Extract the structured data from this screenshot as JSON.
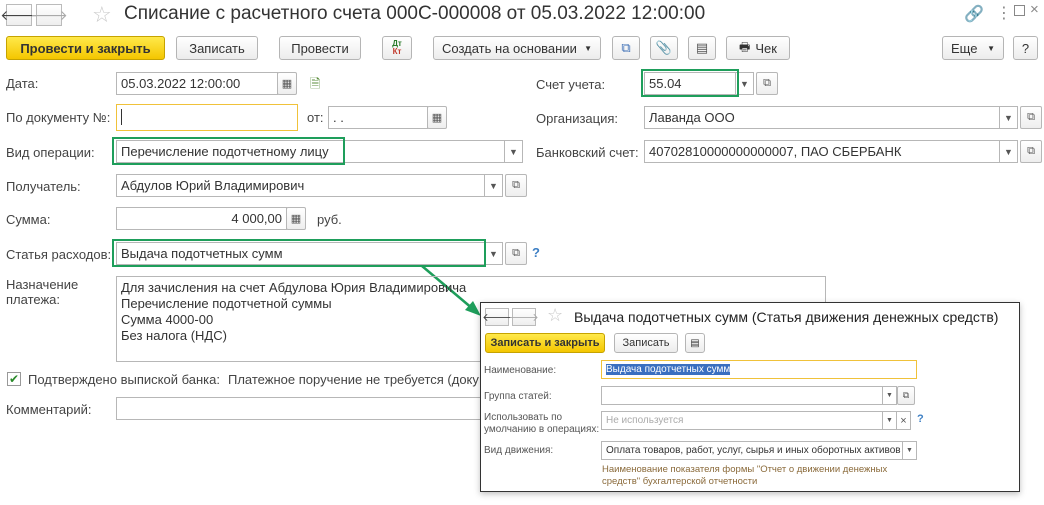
{
  "window": {
    "title": "Списание с расчетного счета 000С-000008 от 05.03.2022 12:00:00"
  },
  "toolbar": {
    "post_close": "Провести и закрыть",
    "save": "Записать",
    "post": "Провести",
    "dt_kt_top": "Дт",
    "dt_kt_bottom": "Кт",
    "create_based": "Создать на основании",
    "receipt": "Чек",
    "more": "Еще",
    "help": "?"
  },
  "form": {
    "date_label": "Дата:",
    "date_value": "05.03.2022 12:00:00",
    "doc_no_label": "По документу №:",
    "doc_no_value": "",
    "from_label": "от:",
    "from_value": "  .  .",
    "operation_label": "Вид операции:",
    "operation_value": "Перечисление подотчетному лицу",
    "recipient_label": "Получатель:",
    "recipient_value": "Абдулов Юрий Владимирович",
    "sum_label": "Сумма:",
    "sum_value": "4 000,00",
    "sum_unit": "руб.",
    "expense_label": "Статья расходов:",
    "expense_value": "Выдача подотчетных сумм",
    "expense_help": "?",
    "purpose_label_1": "Назначение",
    "purpose_label_2": "платежа:",
    "purpose_lines": [
      "Для зачисления на счет Абдулова Юрия Владимировича",
      "Перечисление подотчетной суммы",
      "Сумма 4000-00",
      "Без налога (НДС)"
    ],
    "confirmed_label": "Подтверждено выпиской банка:",
    "confirmed_checked": true,
    "payment_order_text": "Платежное поручение не требуется (доку",
    "comment_label": "Комментарий:",
    "comment_value": "",
    "account_label": "Счет учета:",
    "account_value": "55.04",
    "org_label": "Организация:",
    "org_value": "Лаванда ООО",
    "bank_label": "Банковский счет:",
    "bank_value": "40702810000000000007, ПАО СБЕРБАНК"
  },
  "popup": {
    "title": "Выдача подотчетных сумм (Статья движения денежных средств)",
    "save_close": "Записать и закрыть",
    "save": "Записать",
    "name_label": "Наименование:",
    "name_value": "Выдача подотчетных сумм",
    "group_label": "Группа статей:",
    "group_value": "",
    "default_label_1": "Использовать по",
    "default_label_2": "умолчанию в операциях:",
    "default_placeholder": "Не используется",
    "default_help": "?",
    "movement_label": "Вид движения:",
    "movement_value": "Оплата товаров, работ, услуг, сырья и иных оборотных активов",
    "hint_line_1": "Наименование показателя формы \"Отчет о движении денежных",
    "hint_line_2": "средств\" бухгалтерской отчетности"
  },
  "colors": {
    "accent_green": "#1e9e5b",
    "primary_yellow": "#f4c600",
    "focus_yellow": "#f0c23a"
  }
}
